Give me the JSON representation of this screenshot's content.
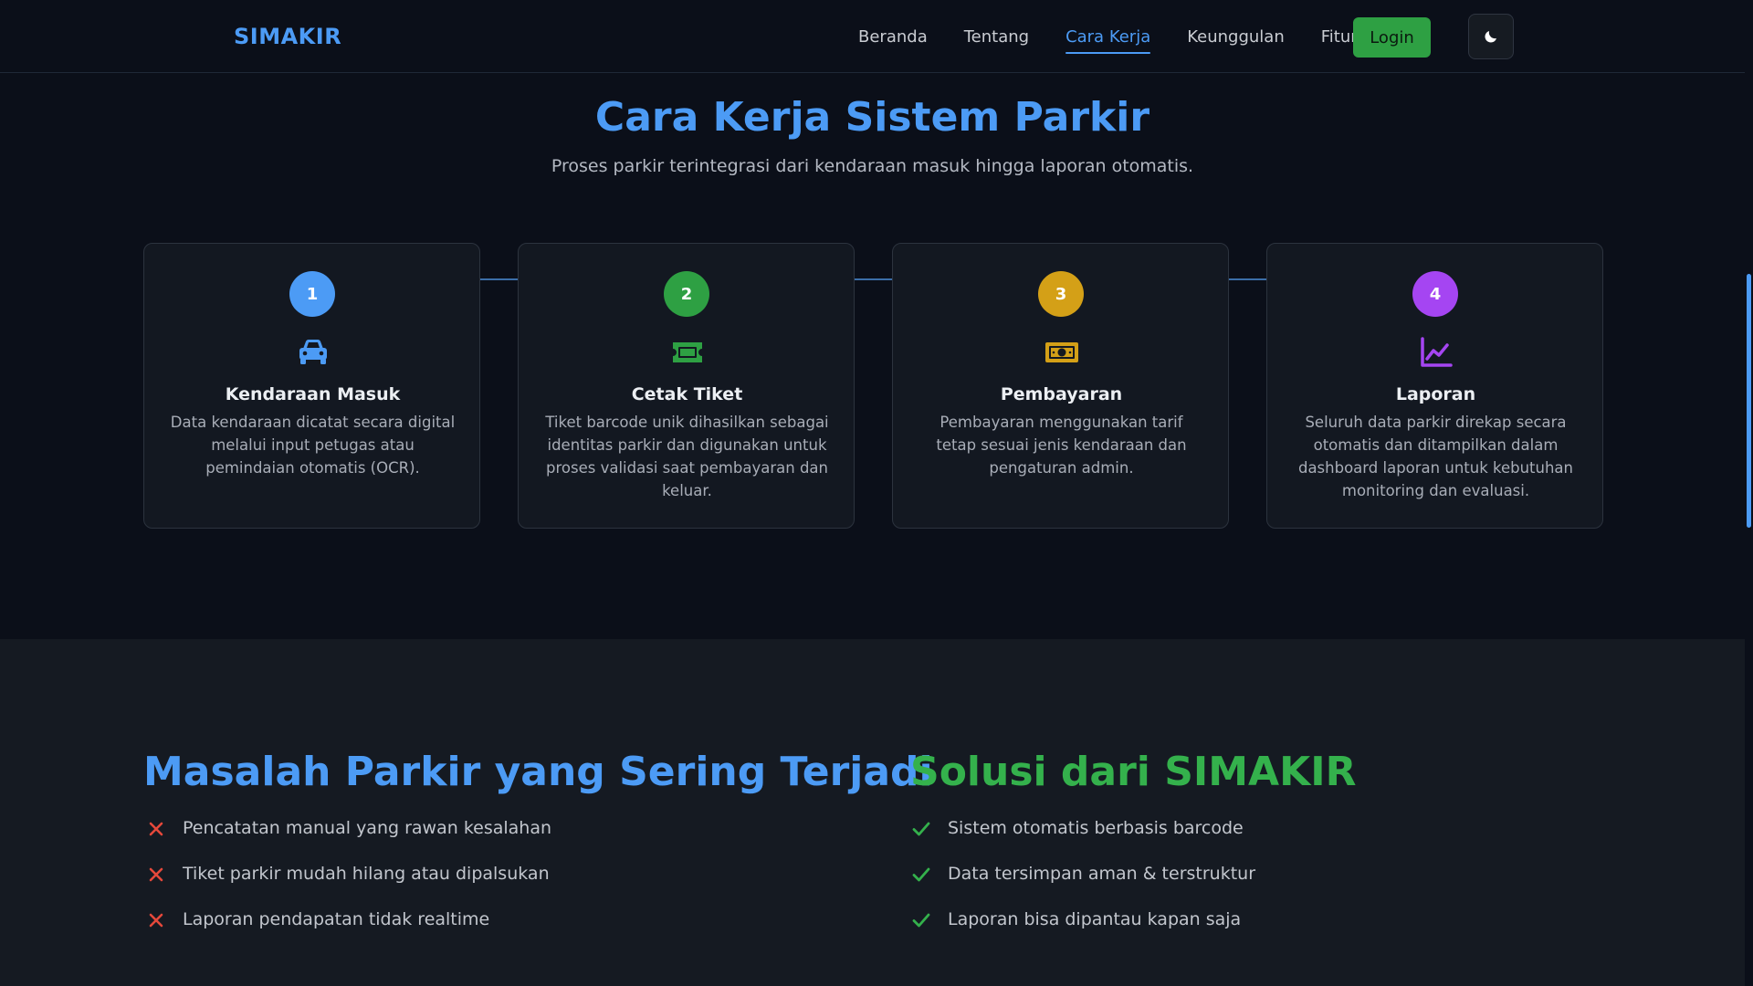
{
  "navbar": {
    "brand": "SIMAKIR",
    "links": [
      "Beranda",
      "Tentang",
      "Cara Kerja",
      "Keunggulan",
      "Fitur"
    ],
    "active_link": "Cara Kerja",
    "login_label": "Login",
    "theme_icon": "moon-icon"
  },
  "how": {
    "title": "Cara Kerja Sistem Parkir",
    "subtitle": "Proses parkir terintegrasi dari kendaraan masuk hingga laporan otomatis.",
    "steps": [
      {
        "number": "1",
        "color": "#4c9bf5",
        "icon": "car-icon",
        "title": "Kendaraan Masuk",
        "desc": "Data kendaraan dicatat secara digital melalui input petugas atau pemindaian otomatis (OCR)."
      },
      {
        "number": "2",
        "color": "#2ea043",
        "icon": "ticket-icon",
        "title": "Cetak Tiket",
        "desc": "Tiket barcode unik dihasilkan sebagai identitas parkir dan digunakan untuk proses validasi saat pembayaran dan keluar."
      },
      {
        "number": "3",
        "color": "#d4a017",
        "icon": "money-icon",
        "title": "Pembayaran",
        "desc": "Pembayaran menggunakan tarif tetap sesuai jenis kendaraan dan pengaturan admin."
      },
      {
        "number": "4",
        "color": "#a545f2",
        "icon": "chart-line-icon",
        "title": "Laporan",
        "desc": "Seluruh data parkir direkap secara otomatis dan ditampilkan dalam dashboard laporan untuk kebutuhan monitoring dan evaluasi."
      }
    ]
  },
  "problems": {
    "title": "Masalah Parkir yang Sering Terjadi",
    "items": [
      "Pencatatan manual yang rawan kesalahan",
      "Tiket parkir mudah hilang atau dipalsukan",
      "Laporan pendapatan tidak realtime"
    ],
    "color": "#4c9bf5",
    "mark_color": "#e5483b"
  },
  "solutions": {
    "title": "Solusi dari SIMAKIR",
    "items": [
      "Sistem otomatis berbasis barcode",
      "Data tersimpan aman & terstruktur",
      "Laporan bisa dipantau kapan saja"
    ],
    "color": "#34b14c",
    "mark_color": "#34b14c"
  }
}
